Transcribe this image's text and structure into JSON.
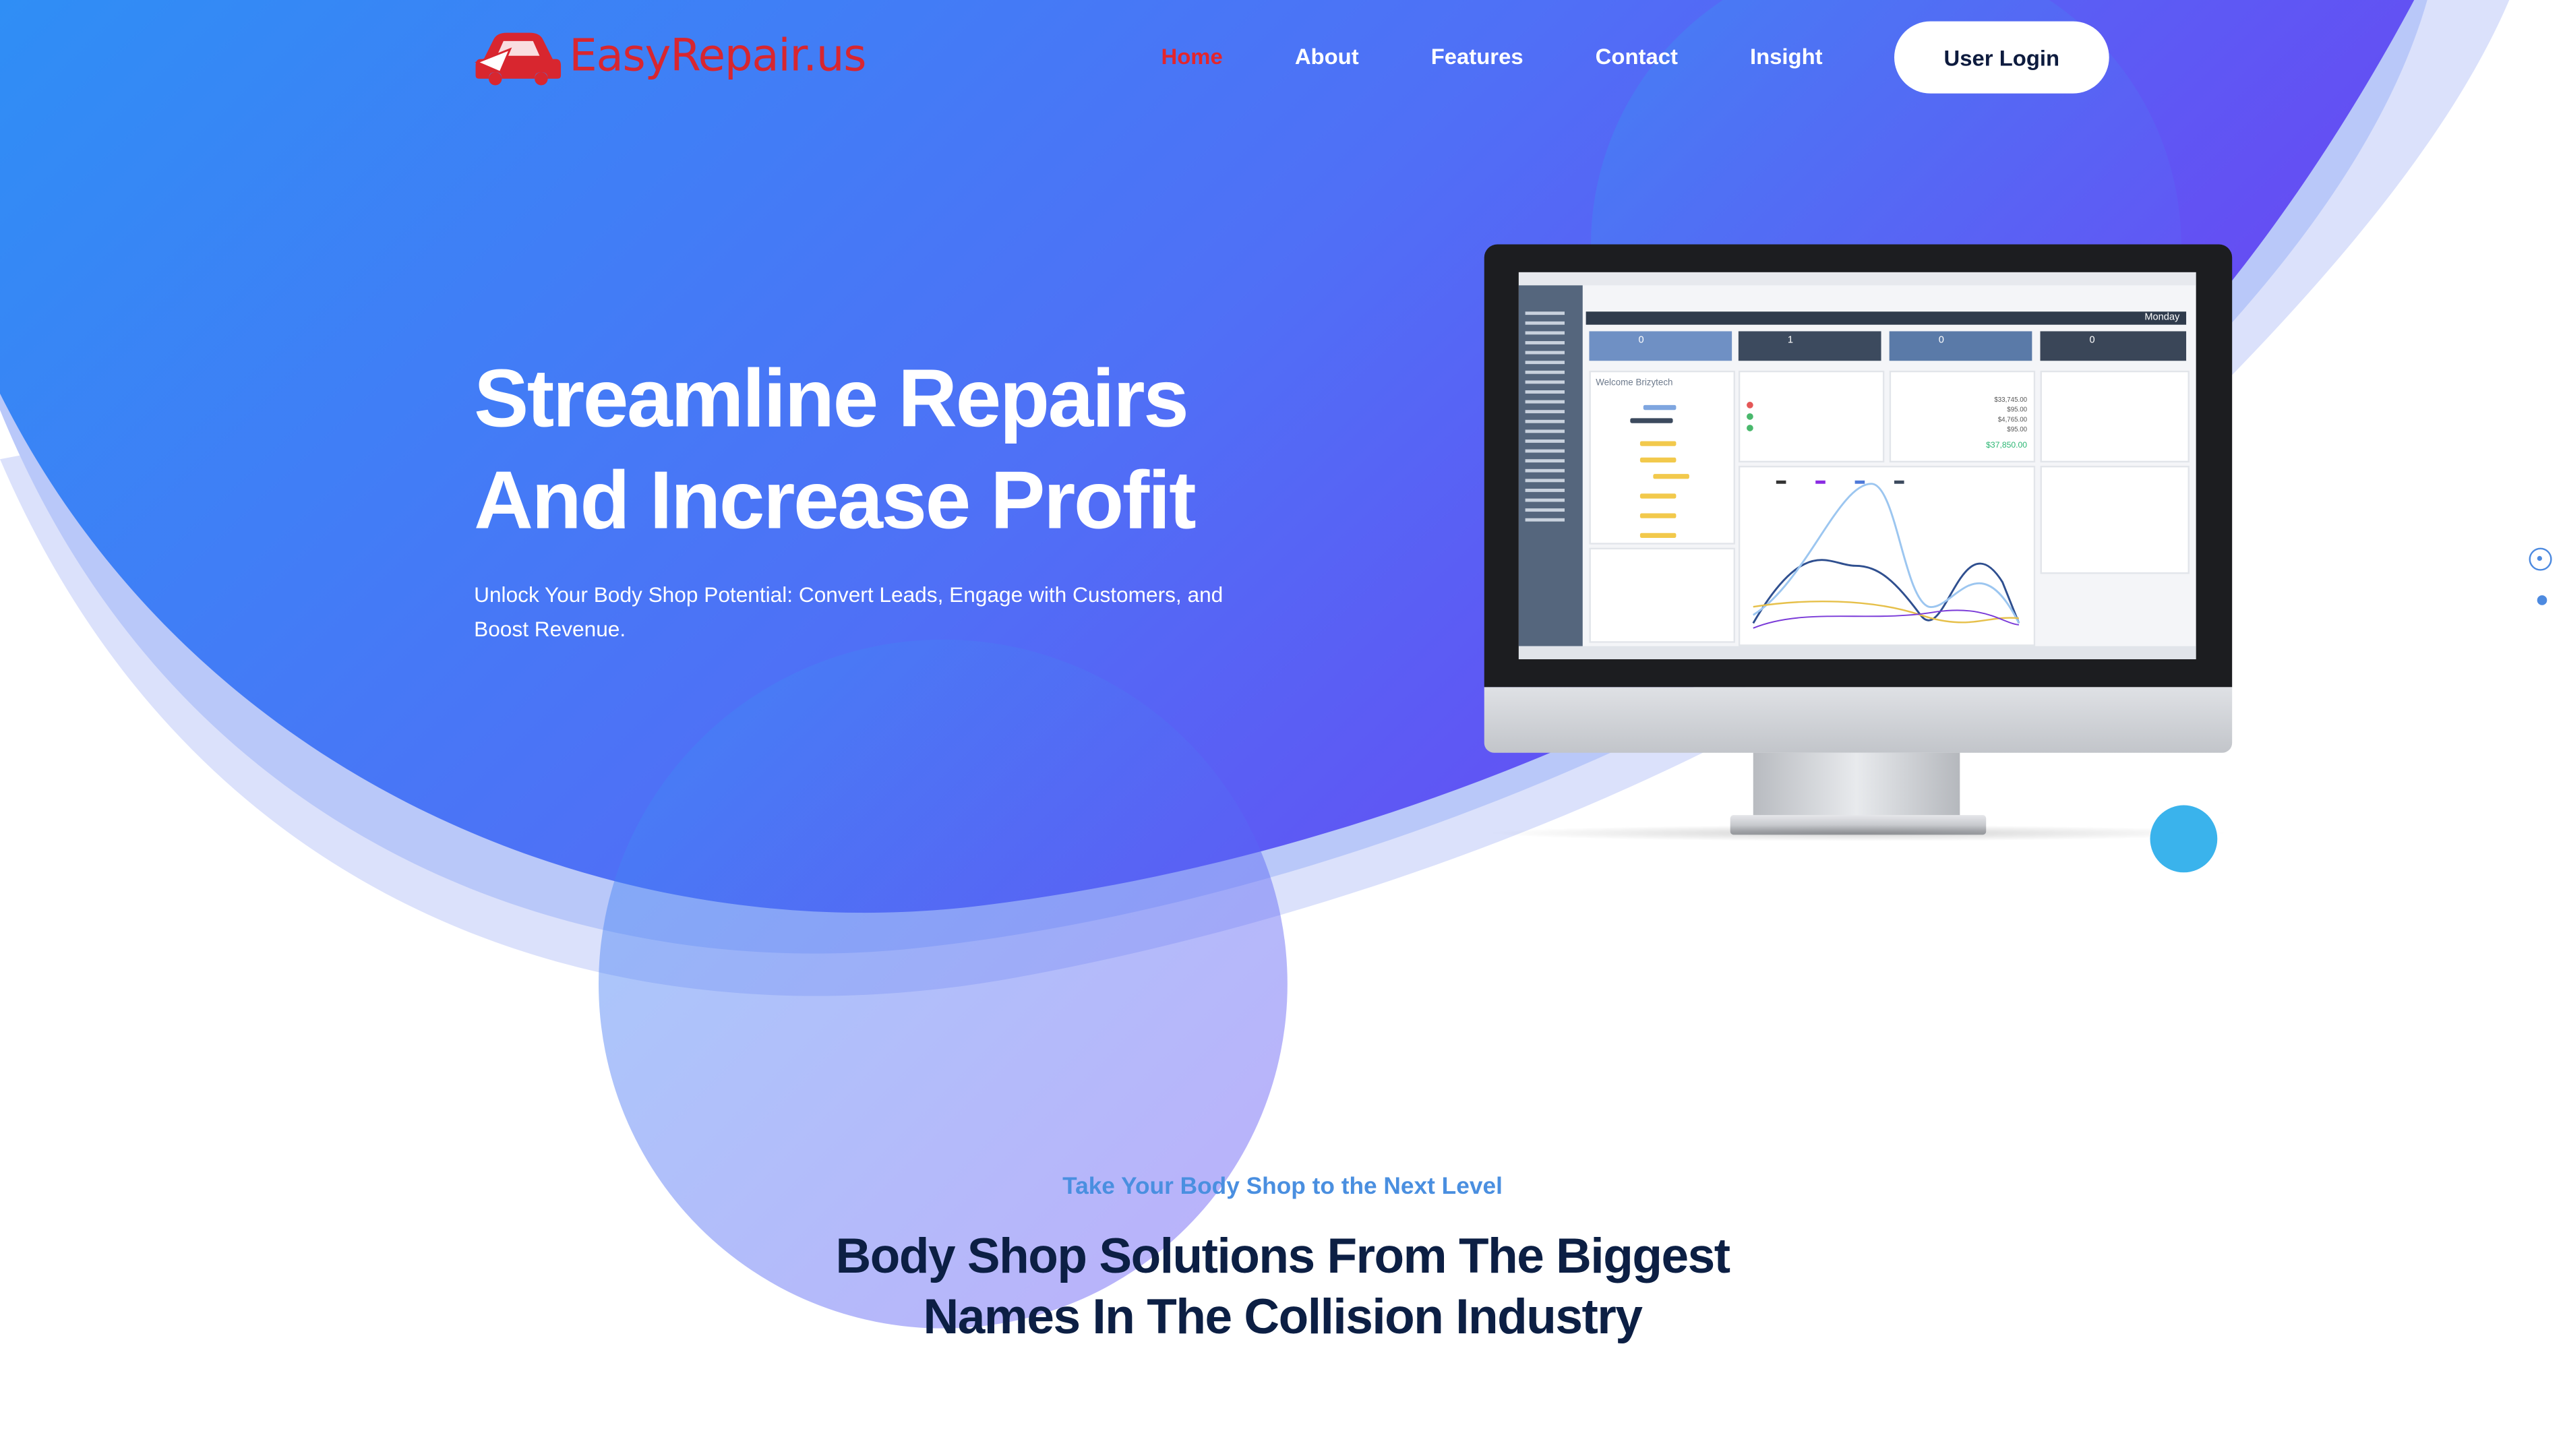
{
  "brand": {
    "name": "EasyRepair",
    "tld": ".us"
  },
  "nav": {
    "items": [
      {
        "label": "Home",
        "active": true
      },
      {
        "label": "About",
        "active": false
      },
      {
        "label": "Features",
        "active": false
      },
      {
        "label": "Contact",
        "active": false
      },
      {
        "label": "Insight",
        "active": false
      }
    ],
    "login_label": "User Login"
  },
  "hero": {
    "title_line1": "Streamline Repairs",
    "title_line2": "And Increase Profit",
    "subtitle": "Unlock Your Body Shop Potential: Convert Leads, Engage with Customers, and Boost Revenue."
  },
  "dashboard_preview": {
    "day": "Monday",
    "welcome": "Welcome Brizytech",
    "cards": [
      "0",
      "1",
      "0",
      "0"
    ],
    "totals": [
      "$33,745.00",
      "$95.00",
      "$4,765.00",
      "$95.00"
    ],
    "total_amount": "$37,850.00"
  },
  "section": {
    "eyebrow": "Take Your Body Shop to the Next Level",
    "title_line1": "Body Shop Solutions From The Biggest",
    "title_line2": "Names In The Collision Industry"
  },
  "colors": {
    "brand_red": "#d8262f",
    "hero_blue": "#2f8ef5",
    "hero_purple": "#6450f3",
    "title_navy": "#0c1f44",
    "eyebrow_blue": "#4a8fe0"
  }
}
